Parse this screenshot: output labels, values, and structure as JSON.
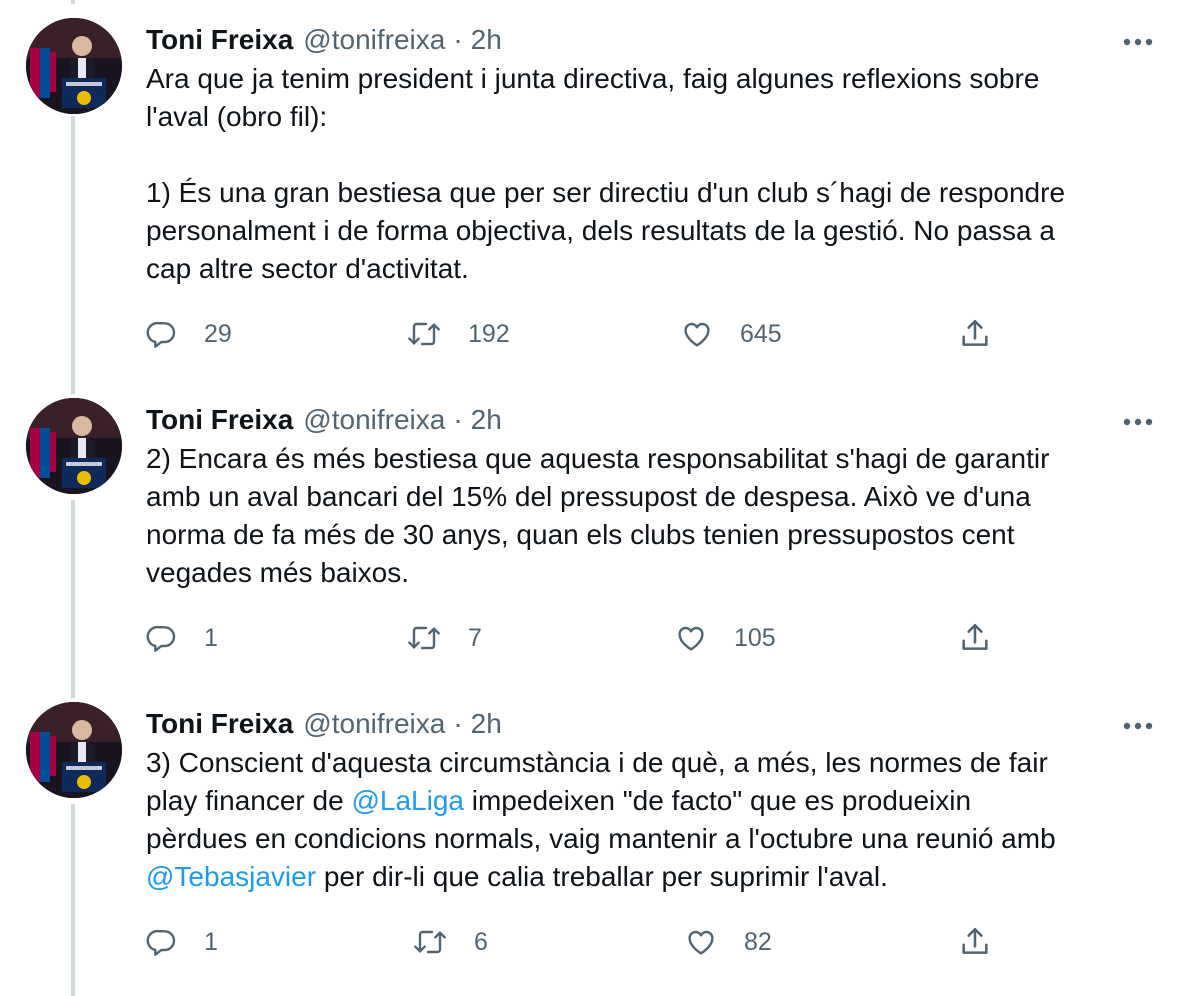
{
  "tweets": [
    {
      "author": "Toni Freixa",
      "handle": "@tonifreixa",
      "separator": "·",
      "time": "2h",
      "segments": [
        {
          "text": "Ara que ja tenim president i junta directiva, faig algunes reflexions sobre\nl'aval (obro fil):\n\n1) És una gran bestiesa que per ser directiu d'un club s´hagi de respondre\npersonalment i de forma objectiva, dels resultats de la gestió. No passa a\ncap altre sector d'activitat."
        }
      ],
      "replies": "29",
      "retweets": "192",
      "likes": "645"
    },
    {
      "author": "Toni Freixa",
      "handle": "@tonifreixa",
      "separator": "·",
      "time": "2h",
      "segments": [
        {
          "text": "2) Encara és més bestiesa que aquesta responsabilitat s'hagi de garantir\namb un aval bancari del 15% del pressupost de despesa. Això ve d'una\nnorma de fa més de 30 anys, quan els clubs tenien pressupostos cent\nvegades més baixos."
        }
      ],
      "replies": "1",
      "retweets": "7",
      "likes": "105"
    },
    {
      "author": "Toni Freixa",
      "handle": "@tonifreixa",
      "separator": "·",
      "time": "2h",
      "segments": [
        {
          "text": "3) Conscient d'aquesta circumstància i de què, a més, les normes de fair\nplay financer de "
        },
        {
          "text": "@LaLiga",
          "mention": true
        },
        {
          "text": " impedeixen \"de facto\" que es produeixin\npèrdues en condicions normals, vaig mantenir a l'octubre una reunió amb\n"
        },
        {
          "text": "@Tebasjavier",
          "mention": true
        },
        {
          "text": " per dir-li que calia treballar per suprimir l'aval."
        }
      ],
      "replies": "1",
      "retweets": "6",
      "likes": "82"
    }
  ],
  "icons": {
    "reply": "reply-icon",
    "retweet": "retweet-icon",
    "like": "like-icon",
    "share": "share-icon",
    "more": "more-icon",
    "avatar": "avatar"
  },
  "colors": {
    "text": "#0f1419",
    "secondary": "#536471",
    "mention": "#1d9bf0",
    "thread_line": "#cfd9de"
  }
}
